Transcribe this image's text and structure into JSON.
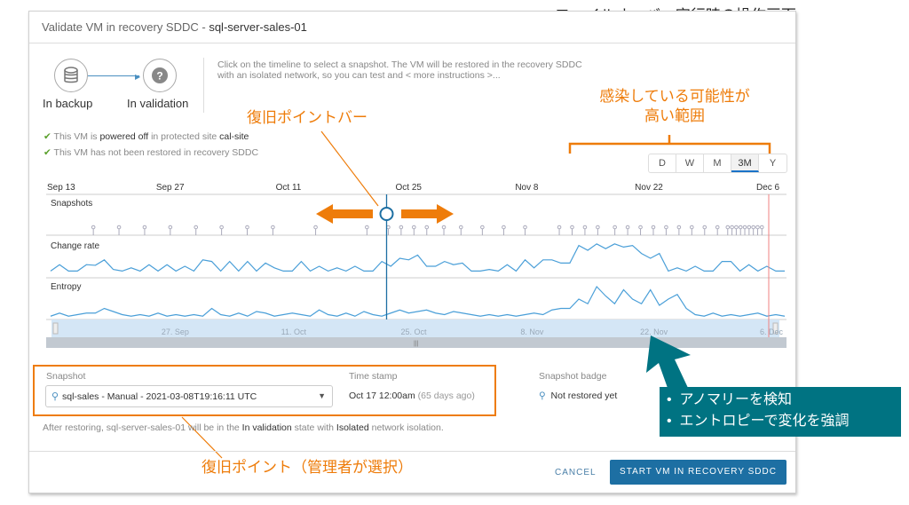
{
  "annotation_title": "フェイルオーバー実行時の操作画面",
  "dialog": {
    "title_prefix": "Validate VM in recovery SDDC - ",
    "vm_name": "sql-server-sales-01"
  },
  "workflow": {
    "step1": "In backup",
    "step2": "In validation"
  },
  "instructions": {
    "line1": "Click on the timeline to select a snapshot. The VM will be restored in the recovery SDDC",
    "line2": "with an isolated network, so you can test and < more instructions >..."
  },
  "status": [
    {
      "parts": [
        "This VM is ",
        "powered off",
        " in protected site ",
        "cal-site"
      ]
    },
    {
      "parts": [
        "This VM has not been restored in recovery SDDC"
      ]
    }
  ],
  "range_buttons": [
    "D",
    "W",
    "M",
    "3M",
    "Y"
  ],
  "range_selected": "3M",
  "callouts": {
    "restore_bar": "復旧ポイントバー",
    "infection_line1": "感染している可能性が",
    "infection_line2": "高い範囲",
    "restore_point": "復旧ポイント（管理者が選択）",
    "anomaly1": "アノマリーを検知",
    "anomaly2": "エントロピーで変化を強調"
  },
  "colors": {
    "accent": "#1d6fa3",
    "orange": "#ee7c0a",
    "teal": "#007382",
    "line": "#4a9fd8"
  },
  "chart_data": {
    "type": "line",
    "x_ticks": [
      "Sep 13",
      "Sep 27",
      "Oct 11",
      "Oct 25",
      "Nov 8",
      "Nov 22",
      "Dec 6"
    ],
    "nav_ticks": [
      "27. Sep",
      "11. Oct",
      "25. Oct",
      "8. Nov",
      "22. Nov",
      "6. Dec"
    ],
    "x_range_days": [
      0,
      84
    ],
    "rows": [
      "Snapshots",
      "Change rate",
      "Entropy"
    ],
    "snapshot_days": [
      5,
      8,
      11,
      14,
      17,
      20,
      23,
      26,
      31,
      37,
      39.5,
      41,
      42.5,
      44,
      46,
      48,
      50.5,
      53,
      55.5,
      59.5,
      61,
      62.5,
      64,
      66,
      67.5,
      69,
      70.5,
      72,
      73.5,
      75,
      76.5,
      78,
      79.2,
      79.7,
      80.2,
      80.7,
      81.2,
      81.7,
      82.2,
      82.7,
      83.2
    ],
    "selected_snapshot_day": 39.3,
    "current_day": 84,
    "change_rate": [
      0.1,
      0.3,
      0.1,
      0.1,
      0.3,
      0.28,
      0.45,
      0.15,
      0.1,
      0.2,
      0.1,
      0.3,
      0.1,
      0.3,
      0.1,
      0.25,
      0.1,
      0.45,
      0.4,
      0.1,
      0.4,
      0.1,
      0.4,
      0.1,
      0.35,
      0.2,
      0.1,
      0.1,
      0.4,
      0.1,
      0.25,
      0.1,
      0.2,
      0.1,
      0.25,
      0.1,
      0.1,
      0.4,
      0.25,
      0.5,
      0.45,
      0.6,
      0.25,
      0.25,
      0.4,
      0.3,
      0.35,
      0.1,
      0.1,
      0.15,
      0.1,
      0.3,
      0.1,
      0.45,
      0.2,
      0.45,
      0.45,
      0.35,
      0.35,
      0.9,
      0.75,
      0.95,
      0.8,
      0.95,
      0.85,
      0.9,
      0.65,
      0.5,
      0.65,
      0.1,
      0.2,
      0.1,
      0.25,
      0.1,
      0.1,
      0.4,
      0.4,
      0.1,
      0.3,
      0.1,
      0.25,
      0.1,
      0.1
    ],
    "entropy": [
      0.05,
      0.15,
      0.05,
      0.1,
      0.15,
      0.15,
      0.3,
      0.2,
      0.1,
      0.05,
      0.1,
      0.05,
      0.15,
      0.05,
      0.1,
      0.05,
      0.1,
      0.05,
      0.3,
      0.1,
      0.05,
      0.15,
      0.05,
      0.2,
      0.15,
      0.05,
      0.1,
      0.15,
      0.1,
      0.05,
      0.25,
      0.1,
      0.05,
      0.15,
      0.05,
      0.2,
      0.1,
      0.05,
      0.15,
      0.25,
      0.15,
      0.2,
      0.25,
      0.15,
      0.1,
      0.2,
      0.15,
      0.1,
      0.05,
      0.1,
      0.05,
      0.1,
      0.05,
      0.1,
      0.15,
      0.1,
      0.25,
      0.3,
      0.3,
      0.6,
      0.45,
      1.0,
      0.7,
      0.45,
      0.9,
      0.6,
      0.45,
      0.9,
      0.4,
      0.6,
      0.75,
      0.3,
      0.1,
      0.05,
      0.15,
      0.05,
      0.1,
      0.05,
      0.1,
      0.15,
      0.05,
      0.1,
      0.05
    ]
  },
  "form": {
    "snapshot_label": "Snapshot",
    "snapshot_value": "sql-sales - Manual - 2021-03-08T19:16:11 UTC",
    "timestamp_label": "Time stamp",
    "timestamp_value": "Oct 17 12:00am",
    "timestamp_ago": "(65 days ago)",
    "badge_label": "Snapshot badge",
    "badge_value": "Not restored yet"
  },
  "note": {
    "p1": "After restoring, sql-server-sales-01 will be in the ",
    "s1": "In validation",
    "p2": " state with ",
    "s2": "Isolated",
    "p3": " network isolation."
  },
  "footer": {
    "cancel": "CANCEL",
    "start": "START VM IN RECOVERY SDDC"
  }
}
